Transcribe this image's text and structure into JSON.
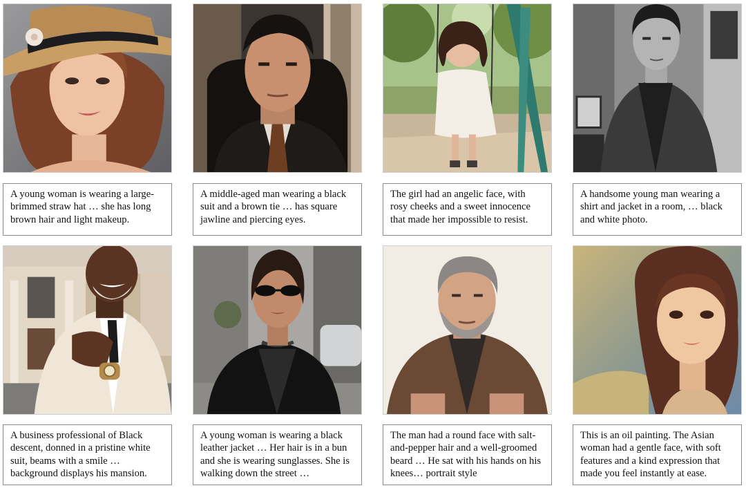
{
  "captions": [
    "A young woman is wearing a large-brimmed straw hat … she has long brown hair and light makeup.",
    "A middle-aged man wearing a black suit and a brown tie … has square jawline and piercing eyes.",
    "The girl had an angelic face, with rosy cheeks and a sweet innocence that made her impossible to resist.",
    "A handsome young man wearing a shirt and jacket in a room, … black and white photo.",
    "A business professional of Black descent, donned in a pristine white suit, beams with a smile  … background displays his mansion.",
    "A young woman is wearing a black leather jacket … Her hair is in a bun and she is wearing sunglasses. She is walking down the street …",
    "The man had a round face with salt-and-pepper hair and a well-groomed beard … He sat with his hands on his knees…  portrait style",
    "This is an oil painting. The Asian woman had a gentle face, with soft features and a kind expression that made you feel instantly at ease."
  ]
}
